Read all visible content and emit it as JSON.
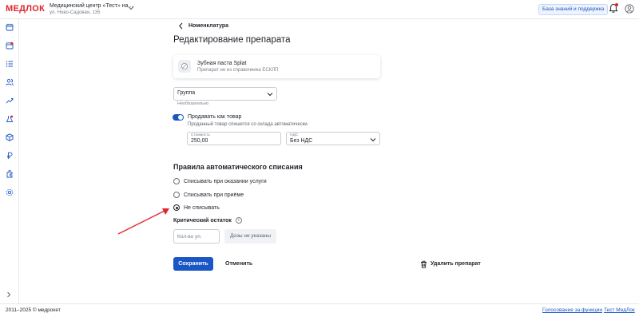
{
  "brand": {
    "logo": "МЕДЛОК",
    "accent": "#e0252e"
  },
  "header": {
    "clinic_name": "Медицинский центр «Тест» на ...",
    "clinic_address": "ул. Ново-Садовая, 135",
    "kb_button": "База знаний и поддержка"
  },
  "page": {
    "back_label": "Номенклатура",
    "title": "Редактирование препарата"
  },
  "drug_card": {
    "name": "Зубная паста Splat",
    "subtitle": "Препарат не из справочника ЕСКЛП"
  },
  "group": {
    "value": "Группа",
    "hint": "Необязательно"
  },
  "sell": {
    "enabled": true,
    "label": "Продавать как товар",
    "description": "Проданный товар спишется со склада автоматически."
  },
  "cost": {
    "caption": "Стоимость",
    "value": "250,00"
  },
  "vat": {
    "caption": "НДС",
    "value": "Без НДС"
  },
  "rules": {
    "title": "Правила автоматического списания",
    "options": [
      {
        "label": "Списывать при оказании услуги",
        "selected": false
      },
      {
        "label": "Списывать при приёме",
        "selected": false
      },
      {
        "label": "Не списывать",
        "selected": true
      }
    ]
  },
  "critical": {
    "label": "Критический остаток",
    "qty_placeholder": "Кол-во уп.",
    "doses_label": "Дозы не указаны"
  },
  "actions": {
    "save": "Сохранить",
    "cancel": "Отменить",
    "delete": "Удалить препарат"
  },
  "footer": {
    "copyright": "2011–2025 © медрокет",
    "link_vote": "Голосование за функции",
    "link_test": "Тест МедЛок"
  },
  "sidebar_icons": [
    "calendar-icon",
    "schedule-icon",
    "list-icon",
    "patients-icon",
    "analytics-icon",
    "lab-icon",
    "box-icon",
    "ruble-icon",
    "integrations-icon",
    "settings-icon"
  ],
  "colors": {
    "primary": "#1a56c4",
    "annotation_arrow": "#e0252e"
  }
}
